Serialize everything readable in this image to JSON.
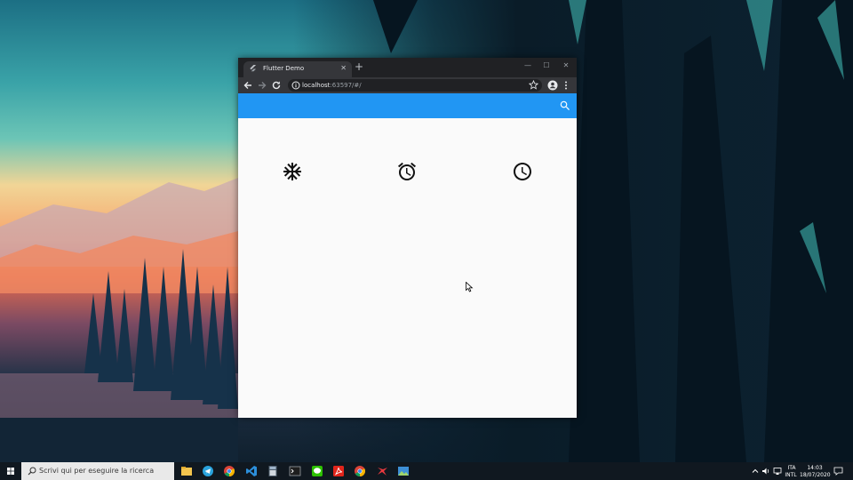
{
  "browser": {
    "tab_title": "Flutter Demo",
    "tab_close": "✕",
    "new_tab": "+",
    "window_controls": {
      "minimize": "—",
      "maximize": "☐",
      "close": "✕"
    },
    "url_host": "localhost",
    "url_rest": ":63597/#/"
  },
  "app": {
    "appbar_color": "#2196F3",
    "appbar_actions": [
      "search-icon"
    ],
    "body_icons": [
      "ac-unit-icon",
      "access-alarm-icon",
      "access-time-icon"
    ]
  },
  "taskbar": {
    "search_placeholder": "Scrivi qui per eseguire la ricerca",
    "pinned_icons": [
      "file-explorer-icon",
      "telegram-icon",
      "chrome-icon",
      "vscode-icon",
      "calculator-icon",
      "terminal-icon",
      "wechat-icon",
      "acrobat-icon",
      "chrome-icon",
      "game-icon",
      "photos-icon"
    ],
    "language": "ITA",
    "layout": "INTL",
    "time": "14:03",
    "date": "18/07/2020"
  }
}
